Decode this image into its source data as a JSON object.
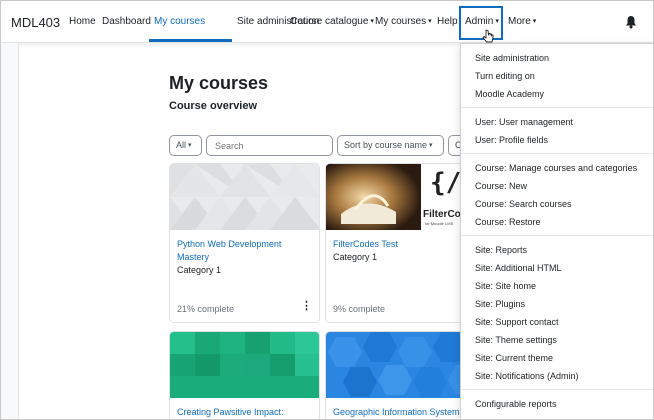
{
  "navbar": {
    "brand": "MDL403",
    "items": [
      {
        "label": "Home"
      },
      {
        "label": "Dashboard"
      },
      {
        "label": "My courses"
      },
      {
        "label": "Site administration"
      },
      {
        "label": "Course catalogue"
      },
      {
        "label": "My courses"
      },
      {
        "label": "Help"
      },
      {
        "label": "Admin"
      },
      {
        "label": "More"
      }
    ],
    "active_item": "My courses",
    "icons": [
      "chevron-down-icon",
      "bell-icon"
    ],
    "accent_color": "#0f6cbf"
  },
  "main": {
    "title": "My courses",
    "section": "Course overview",
    "filters": {
      "grouping": "All",
      "search_placeholder": "Search",
      "sort": "Sort by course name",
      "view_partial": "Ca"
    },
    "courses": [
      {
        "title": "Python Web Development Mastery",
        "category": "Category 1",
        "progress_text": "21% complete",
        "progress": 21
      },
      {
        "title": "FilterCodes Test",
        "category": "Category 1",
        "progress_text": "9% complete",
        "progress": 9,
        "image_text": "FilterCodes",
        "image_subtext": "for Moodle LMS",
        "image_logo": "{/}"
      },
      {
        "title": "Creating Pawsitive Impact: Starting",
        "category": "",
        "progress_text": ""
      },
      {
        "title": "Geographic Information Systems",
        "category": "",
        "progress_text": ""
      }
    ]
  },
  "admin_menu": {
    "groups": [
      [
        "Site administration",
        "Turn editing on",
        "Moodle Academy"
      ],
      [
        "User: User management",
        "User: Profile fields"
      ],
      [
        "Course: Manage courses and categories",
        "Course: New",
        "Course: Search courses",
        "Course: Restore"
      ],
      [
        "Site: Reports",
        "Site: Additional HTML",
        "Site: Site home",
        "Site: Plugins",
        "Site: Support contact",
        "Site: Theme settings",
        "Site: Current theme",
        "Site: Notifications (Admin)"
      ],
      [
        "Configurable reports"
      ]
    ]
  }
}
